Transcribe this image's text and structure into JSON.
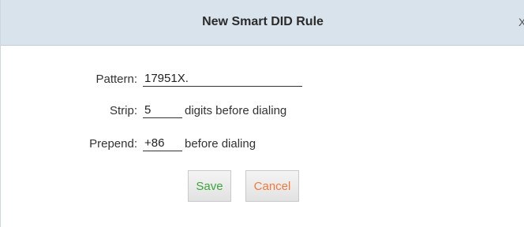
{
  "dialog": {
    "title": "New Smart DID Rule",
    "close_label": "X"
  },
  "form": {
    "pattern": {
      "label": "Pattern:",
      "value": "17951X."
    },
    "strip": {
      "label": "Strip:",
      "value": "5",
      "suffix": "digits before dialing"
    },
    "prepend": {
      "label": "Prepend:",
      "value": "+86",
      "suffix": "before dialing"
    }
  },
  "buttons": {
    "save_label": "Save",
    "cancel_label": "Cancel"
  },
  "colors": {
    "title_bar": "#d8e3ec",
    "save_text": "#3aa63a",
    "cancel_text": "#f07a3a"
  }
}
